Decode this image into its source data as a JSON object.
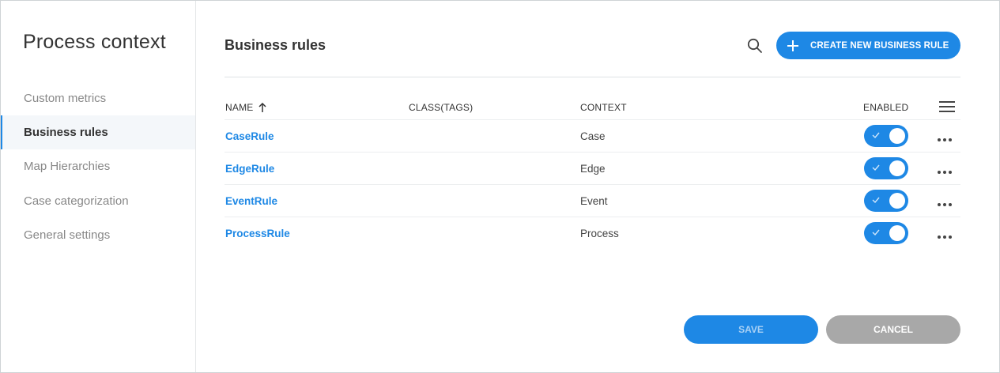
{
  "sidebar": {
    "title": "Process context",
    "items": [
      {
        "label": "Custom metrics"
      },
      {
        "label": "Business rules"
      },
      {
        "label": "Map Hierarchies"
      },
      {
        "label": "Case categorization"
      },
      {
        "label": "General settings"
      }
    ],
    "active_index": 1
  },
  "header": {
    "title": "Business rules",
    "search_icon": "search-icon",
    "create_label": "CREATE NEW BUSINESS RULE"
  },
  "table": {
    "columns": {
      "name": "NAME",
      "class_tags": "CLASS(TAGS)",
      "context": "CONTEXT",
      "enabled": "ENABLED"
    },
    "sort": {
      "column": "name",
      "direction": "ascending"
    },
    "rows": [
      {
        "name": "CaseRule",
        "class_tags": "",
        "context": "Case",
        "enabled": true
      },
      {
        "name": "EdgeRule",
        "class_tags": "",
        "context": "Edge",
        "enabled": true
      },
      {
        "name": "EventRule",
        "class_tags": "",
        "context": "Event",
        "enabled": true
      },
      {
        "name": "ProcessRule",
        "class_tags": "",
        "context": "Process",
        "enabled": true
      }
    ]
  },
  "footer": {
    "save_label": "SAVE",
    "cancel_label": "CANCEL"
  },
  "colors": {
    "accent": "#1e88e5",
    "cancel": "#a8a8a8"
  }
}
